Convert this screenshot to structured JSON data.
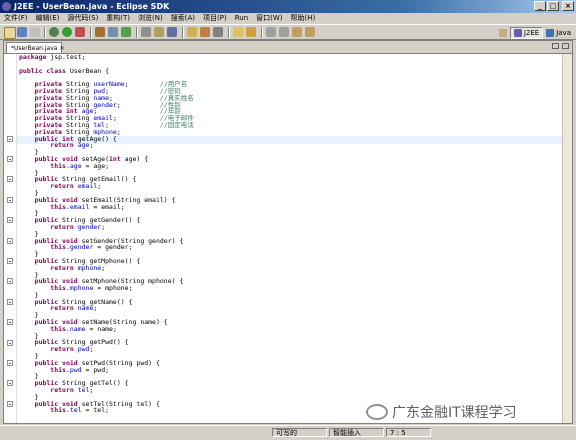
{
  "window": {
    "title": "J2EE - UserBean.java - Eclipse SDK",
    "buttons": [
      "_",
      "□",
      "×"
    ]
  },
  "menu": [
    "文件(F)",
    "编辑(E)",
    "源代码(S)",
    "重构(T)",
    "浏览(N)",
    "搜索(A)",
    "项目(P)",
    "Run",
    "窗口(W)",
    "帮助(H)"
  ],
  "perspectives": {
    "j2ee": "J2EE",
    "java": "Java"
  },
  "editor": {
    "tab_label": "*UserBean.java",
    "tab_close": "×"
  },
  "code_lines": [
    [
      {
        "t": "package",
        "c": "kw"
      },
      {
        "t": " jsp.test;"
      }
    ],
    [
      {
        "t": ""
      }
    ],
    [
      {
        "t": "public class",
        "c": "kw"
      },
      {
        "t": " UserBean {"
      }
    ],
    [
      {
        "t": ""
      }
    ],
    [
      {
        "t": "    private",
        "c": "kw"
      },
      {
        "t": " String "
      },
      {
        "t": "userName",
        "c": "fld"
      },
      {
        "t": ";        "
      },
      {
        "t": "//用户名",
        "c": "cmt"
      }
    ],
    [
      {
        "t": "    private",
        "c": "kw"
      },
      {
        "t": " String "
      },
      {
        "t": "pwd",
        "c": "fld"
      },
      {
        "t": ";             "
      },
      {
        "t": "//密码",
        "c": "cmt"
      }
    ],
    [
      {
        "t": "    private",
        "c": "kw"
      },
      {
        "t": " String "
      },
      {
        "t": "name",
        "c": "fld"
      },
      {
        "t": ";            "
      },
      {
        "t": "//真实姓名",
        "c": "cmt"
      }
    ],
    [
      {
        "t": "    private",
        "c": "kw"
      },
      {
        "t": " String "
      },
      {
        "t": "gender",
        "c": "fld"
      },
      {
        "t": ";          "
      },
      {
        "t": "//性别",
        "c": "cmt"
      }
    ],
    [
      {
        "t": "    private int",
        "c": "kw"
      },
      {
        "t": " "
      },
      {
        "t": "age",
        "c": "fld"
      },
      {
        "t": ";                "
      },
      {
        "t": "//年龄",
        "c": "cmt"
      }
    ],
    [
      {
        "t": "    private",
        "c": "kw"
      },
      {
        "t": " String "
      },
      {
        "t": "email",
        "c": "fld"
      },
      {
        "t": ";           "
      },
      {
        "t": "//电子邮件",
        "c": "cmt"
      }
    ],
    [
      {
        "t": "    private",
        "c": "kw"
      },
      {
        "t": " String "
      },
      {
        "t": "tel",
        "c": "fld"
      },
      {
        "t": ";             "
      },
      {
        "t": "//固定电话",
        "c": "cmt"
      }
    ],
    [
      {
        "t": "    private",
        "c": "kw"
      },
      {
        "t": " String "
      },
      {
        "t": "mphone",
        "c": "fld"
      },
      {
        "t": ";"
      }
    ],
    [
      {
        "t": "    public int",
        "c": "kw"
      },
      {
        "t": " getAge() {"
      }
    ],
    [
      {
        "t": "        return",
        "c": "kw"
      },
      {
        "t": " "
      },
      {
        "t": "age",
        "c": "fld"
      },
      {
        "t": ";"
      }
    ],
    [
      {
        "t": "    }"
      }
    ],
    [
      {
        "t": "    public void",
        "c": "kw"
      },
      {
        "t": " setAge("
      },
      {
        "t": "int",
        "c": "kw"
      },
      {
        "t": " age) {"
      }
    ],
    [
      {
        "t": "        this",
        "c": "kw"
      },
      {
        "t": "."
      },
      {
        "t": "age",
        "c": "fld"
      },
      {
        "t": " = age;"
      }
    ],
    [
      {
        "t": "    }"
      }
    ],
    [
      {
        "t": "    public",
        "c": "kw"
      },
      {
        "t": " String getEmail() {"
      }
    ],
    [
      {
        "t": "        return",
        "c": "kw"
      },
      {
        "t": " "
      },
      {
        "t": "email",
        "c": "fld"
      },
      {
        "t": ";"
      }
    ],
    [
      {
        "t": "    }"
      }
    ],
    [
      {
        "t": "    public void",
        "c": "kw"
      },
      {
        "t": " setEmail(String email) {"
      }
    ],
    [
      {
        "t": "        this",
        "c": "kw"
      },
      {
        "t": "."
      },
      {
        "t": "email",
        "c": "fld"
      },
      {
        "t": " = email;"
      }
    ],
    [
      {
        "t": "    }"
      }
    ],
    [
      {
        "t": "    public",
        "c": "kw"
      },
      {
        "t": " String getGender() {"
      }
    ],
    [
      {
        "t": "        return",
        "c": "kw"
      },
      {
        "t": " "
      },
      {
        "t": "gender",
        "c": "fld"
      },
      {
        "t": ";"
      }
    ],
    [
      {
        "t": "    }"
      }
    ],
    [
      {
        "t": "    public void",
        "c": "kw"
      },
      {
        "t": " setGender(String gender) {"
      }
    ],
    [
      {
        "t": "        this",
        "c": "kw"
      },
      {
        "t": "."
      },
      {
        "t": "gender",
        "c": "fld"
      },
      {
        "t": " = gender;"
      }
    ],
    [
      {
        "t": "    }"
      }
    ],
    [
      {
        "t": "    public",
        "c": "kw"
      },
      {
        "t": " String getMphone() {"
      }
    ],
    [
      {
        "t": "        return",
        "c": "kw"
      },
      {
        "t": " "
      },
      {
        "t": "mphone",
        "c": "fld"
      },
      {
        "t": ";"
      }
    ],
    [
      {
        "t": "    }"
      }
    ],
    [
      {
        "t": "    public void",
        "c": "kw"
      },
      {
        "t": " setMphone(String mphone) {"
      }
    ],
    [
      {
        "t": "        this",
        "c": "kw"
      },
      {
        "t": "."
      },
      {
        "t": "mphone",
        "c": "fld"
      },
      {
        "t": " = mphone;"
      }
    ],
    [
      {
        "t": "    }"
      }
    ],
    [
      {
        "t": "    public",
        "c": "kw"
      },
      {
        "t": " String getName() {"
      }
    ],
    [
      {
        "t": "        return",
        "c": "kw"
      },
      {
        "t": " "
      },
      {
        "t": "name",
        "c": "fld"
      },
      {
        "t": ";"
      }
    ],
    [
      {
        "t": "    }"
      }
    ],
    [
      {
        "t": "    public void",
        "c": "kw"
      },
      {
        "t": " setName(String name) {"
      }
    ],
    [
      {
        "t": "        this",
        "c": "kw"
      },
      {
        "t": "."
      },
      {
        "t": "name",
        "c": "fld"
      },
      {
        "t": " = name;"
      }
    ],
    [
      {
        "t": "    }"
      }
    ],
    [
      {
        "t": "    public",
        "c": "kw"
      },
      {
        "t": " String getPwd() {"
      }
    ],
    [
      {
        "t": "        return",
        "c": "kw"
      },
      {
        "t": " "
      },
      {
        "t": "pwd",
        "c": "fld"
      },
      {
        "t": ";"
      }
    ],
    [
      {
        "t": "    }"
      }
    ],
    [
      {
        "t": "    public void",
        "c": "kw"
      },
      {
        "t": " setPwd(String pwd) {"
      }
    ],
    [
      {
        "t": "        this",
        "c": "kw"
      },
      {
        "t": "."
      },
      {
        "t": "pwd",
        "c": "fld"
      },
      {
        "t": " = pwd;"
      }
    ],
    [
      {
        "t": "    }"
      }
    ],
    [
      {
        "t": "    public",
        "c": "kw"
      },
      {
        "t": " String getTel() {"
      }
    ],
    [
      {
        "t": "        return",
        "c": "kw"
      },
      {
        "t": " "
      },
      {
        "t": "tel",
        "c": "fld"
      },
      {
        "t": ";"
      }
    ],
    [
      {
        "t": "    }"
      }
    ],
    [
      {
        "t": "    public void",
        "c": "kw"
      },
      {
        "t": " setTel(String tel) {"
      }
    ],
    [
      {
        "t": "        this",
        "c": "kw"
      },
      {
        "t": "."
      },
      {
        "t": "tel",
        "c": "fld"
      },
      {
        "t": " = tel;"
      }
    ]
  ],
  "status": {
    "writable": "可写的",
    "insert_mode": "智能插入",
    "position": "7 : 5"
  },
  "watermark": "广东金融IT课程学习",
  "colors": {
    "keyword": "#7f0055",
    "field": "#0000c0",
    "comment": "#3f7f5f",
    "title_bar": "#0a246a"
  }
}
